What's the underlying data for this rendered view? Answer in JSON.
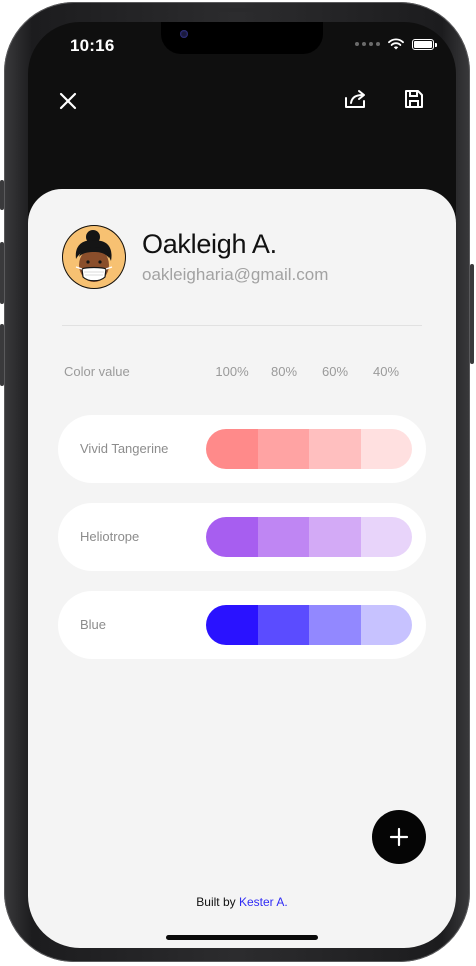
{
  "status_bar": {
    "time": "10:16"
  },
  "toolbar": {
    "close_icon": "close-icon",
    "share_icon": "share-icon",
    "save_icon": "save-icon"
  },
  "profile": {
    "name": "Oakleigh A.",
    "email": "oakleigharia@gmail.com",
    "avatar_icon": "avatar-illustration"
  },
  "table": {
    "header": "Color value",
    "percents": [
      "100%",
      "80%",
      "60%",
      "40%"
    ],
    "rows": [
      {
        "name": "Vivid Tangerine",
        "swatches": [
          "#ff8a8a",
          "#ffa3a3",
          "#ffbfbf",
          "#ffe0e0"
        ]
      },
      {
        "name": "Heliotrope",
        "swatches": [
          "#a75ef0",
          "#bf86f3",
          "#d3aaf6",
          "#e8d4fa"
        ]
      },
      {
        "name": "Blue",
        "swatches": [
          "#2a12ff",
          "#5b4cff",
          "#9288ff",
          "#c7c2ff"
        ]
      }
    ]
  },
  "fab": {
    "icon": "plus-icon"
  },
  "footer": {
    "prefix": "Built by",
    "author": "Kester A."
  }
}
